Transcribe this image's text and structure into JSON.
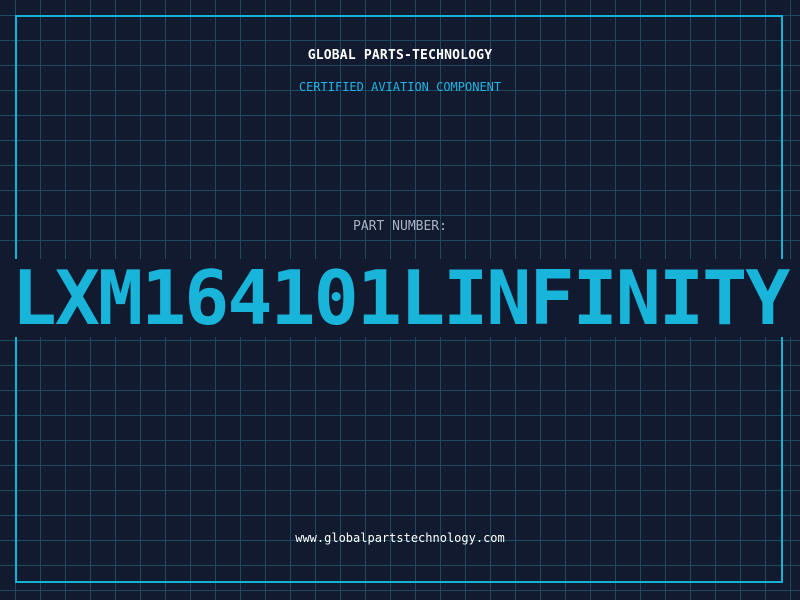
{
  "header": {
    "company": "GLOBAL PARTS-TECHNOLOGY",
    "subtitle": "CERTIFIED AVIATION COMPONENT"
  },
  "part": {
    "label": "PART NUMBER:",
    "number": "LXM164101LINFINITY"
  },
  "footer": {
    "website": "www.globalpartstechnology.com"
  },
  "colors": {
    "background": "#111a2e",
    "grid": "#1f4a5e",
    "accent": "#18b4da",
    "text": "#ffffff"
  }
}
